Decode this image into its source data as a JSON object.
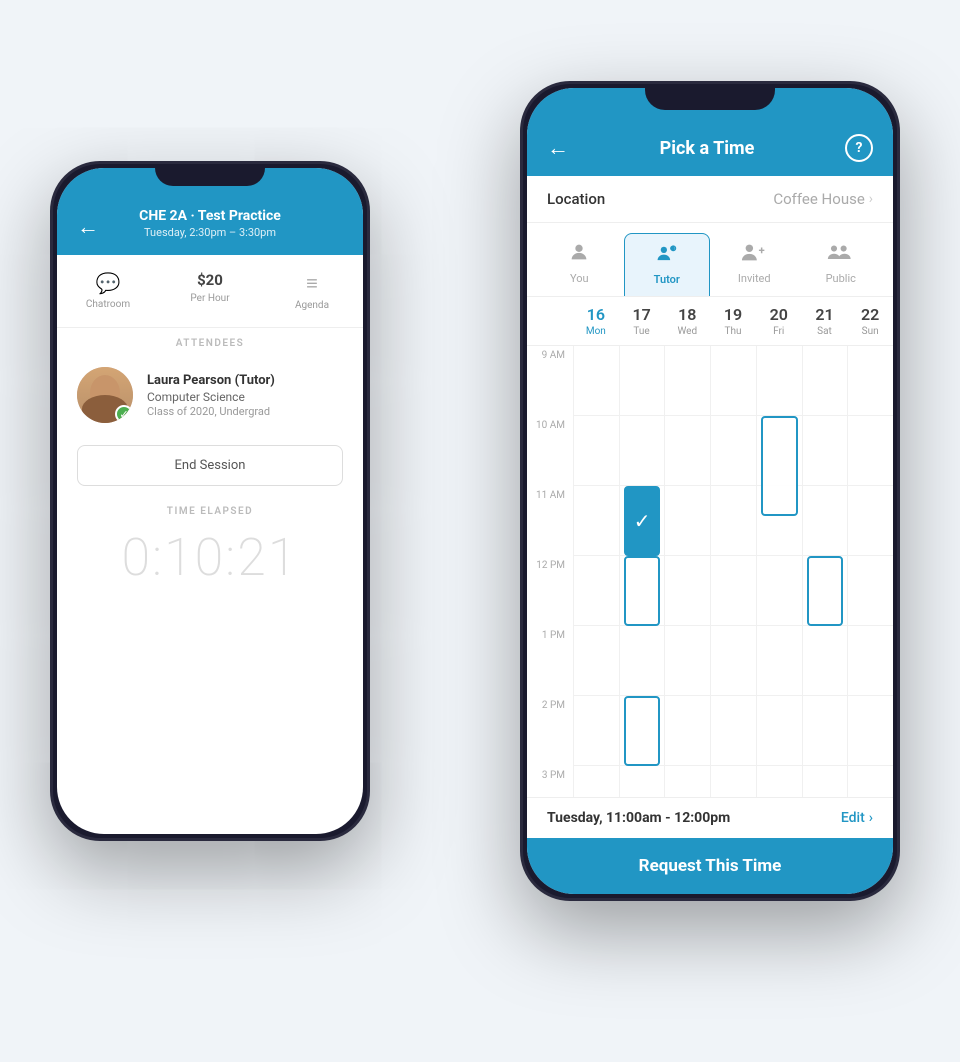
{
  "phone1": {
    "header": {
      "title": "CHE 2A · Test Practice",
      "subtitle": "Tuesday, 2:30pm – 3:30pm",
      "back_icon": "←"
    },
    "actions": [
      {
        "icon": "💬",
        "label": "Chatroom"
      },
      {
        "amount": "$20",
        "sub": "Per Hour"
      },
      {
        "icon": "≡",
        "label": "Agenda"
      }
    ],
    "attendees_label": "ATTENDEES",
    "attendee": {
      "name": "Laura Pearson (Tutor)",
      "field": "Computer Science",
      "class": "Class of 2020, Undergrad"
    },
    "end_session_label": "End Session",
    "time_elapsed_label": "TIME ELAPSED",
    "timer": "0:10:21"
  },
  "phone2": {
    "header": {
      "title": "Pick a Time",
      "back_icon": "←",
      "help_icon": "?"
    },
    "location": {
      "label": "Location",
      "value": "Coffee House",
      "chevron": "›"
    },
    "tabs": [
      {
        "id": "you",
        "label": "You",
        "icon": "👤",
        "active": false
      },
      {
        "id": "tutor",
        "label": "Tutor",
        "icon": "👤✦",
        "active": true
      },
      {
        "id": "invited",
        "label": "Invited",
        "icon": "👥+",
        "active": false
      },
      {
        "id": "public",
        "label": "Public",
        "icon": "👥👥",
        "active": false
      }
    ],
    "days": [
      {
        "num": "16",
        "name": "Mon",
        "today": true
      },
      {
        "num": "17",
        "name": "Tue",
        "today": false
      },
      {
        "num": "18",
        "name": "Wed",
        "today": false
      },
      {
        "num": "19",
        "name": "Thu",
        "today": false
      },
      {
        "num": "20",
        "name": "Fri",
        "today": false
      },
      {
        "num": "21",
        "name": "Sat",
        "today": false
      },
      {
        "num": "22",
        "name": "Sun",
        "today": false
      }
    ],
    "time_labels": [
      "9 AM",
      "10 AM",
      "11 AM",
      "12 PM",
      "1 PM",
      "2 PM",
      "3 PM"
    ],
    "selected_time": {
      "text": "Tuesday, 11:00am - 12:00pm",
      "edit_label": "Edit",
      "chevron": "›"
    },
    "request_button": "Request This Time"
  }
}
